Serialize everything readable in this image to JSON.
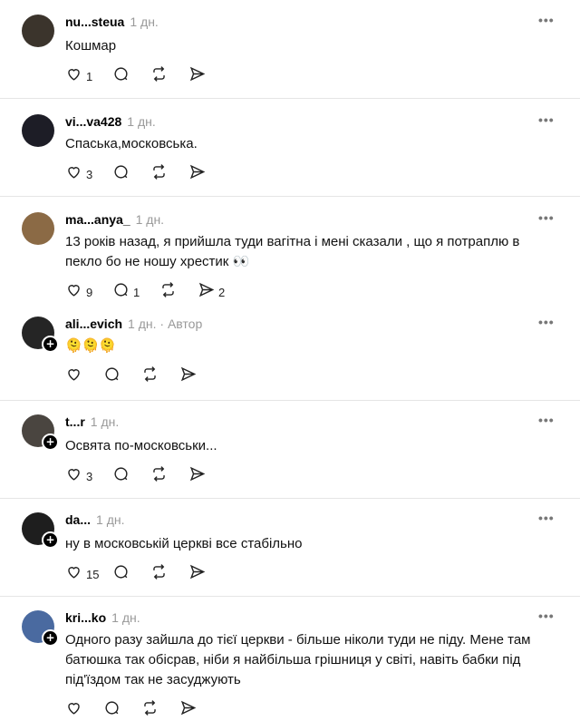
{
  "comments": [
    {
      "username": "nu...steua",
      "time": "1 дн.",
      "text": "Кошмар",
      "likes": "1",
      "replies": "",
      "reposts": "",
      "shares": "",
      "avatar_color": "#3b342c",
      "follow": false
    },
    {
      "username": "vi...va428",
      "time": "1 дн.",
      "text": "Спаська,московська.",
      "likes": "3",
      "replies": "",
      "reposts": "",
      "shares": "",
      "avatar_color": "#1d1d26",
      "follow": false
    },
    {
      "username": "ma...anya_",
      "time": "1 дн.",
      "text": "13 років назад, я прийшла туди вагітна і мені сказали , що я потраплю в пекло бо не ношу хрестик 👀",
      "likes": "9",
      "replies": "1",
      "reposts": "",
      "shares": "2",
      "avatar_color": "#8b6a45",
      "follow": false
    },
    {
      "username": "ali...evich",
      "time": "1 дн.",
      "author": "· Автор",
      "text": "🫠🫠🫠",
      "likes": "",
      "replies": "",
      "reposts": "",
      "shares": "",
      "avatar_color": "#252525",
      "follow": true
    },
    {
      "username": "t...r",
      "time": "1 дн.",
      "text": "Освята по-московськи...",
      "likes": "3",
      "replies": "",
      "reposts": "",
      "shares": "",
      "avatar_color": "#4a4540",
      "follow": true
    },
    {
      "username": "da...",
      "time": "1 дн.",
      "text": "ну в московській церкві все стабільно",
      "likes": "15",
      "replies": "",
      "reposts": "",
      "shares": "",
      "avatar_color": "#1e1e1e",
      "follow": true
    },
    {
      "username": "kri...ko",
      "time": "1 дн.",
      "text": "Одного разу зайшла до тієї церкви - більше ніколи туди не піду. Мене там батюшка так обісрав, ніби я найбільша грішниця у світі, навіть бабки під під'їздом так не засуджують",
      "likes": "",
      "replies": "",
      "reposts": "",
      "shares": "",
      "avatar_color": "#4a6aa0",
      "follow": true
    }
  ],
  "more_label": "•••"
}
